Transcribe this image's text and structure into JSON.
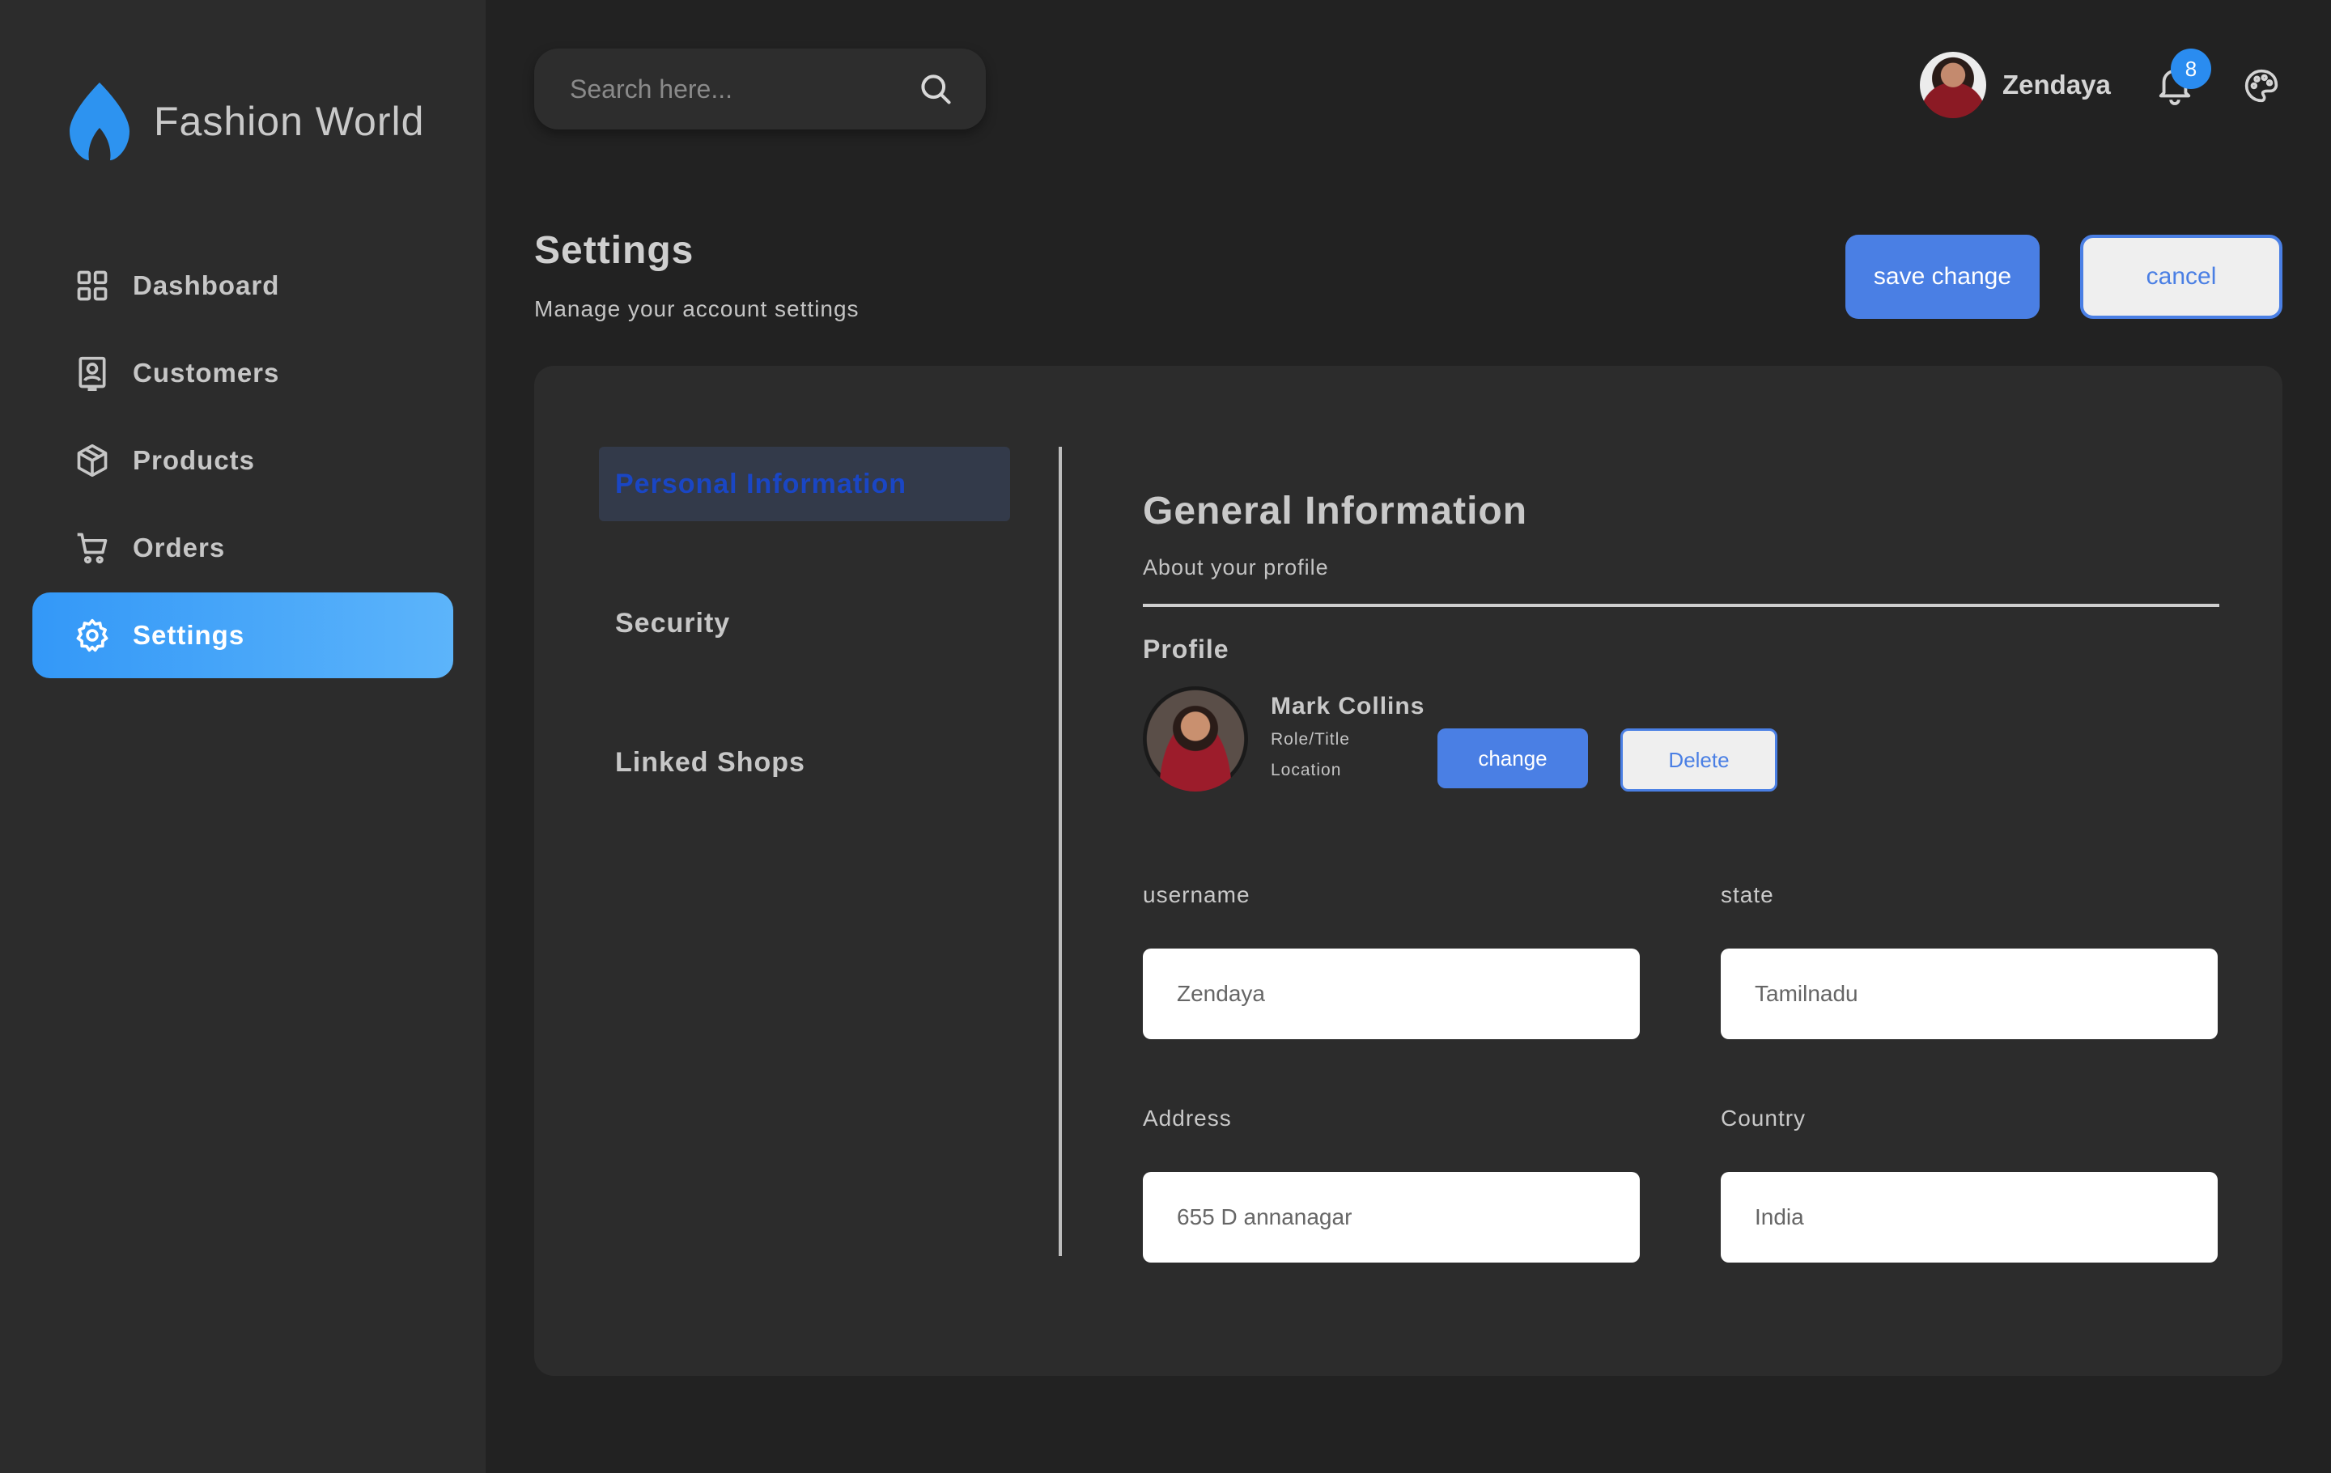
{
  "brand": {
    "name": "Fashion World"
  },
  "sidebar": {
    "items": [
      {
        "id": "dashboard",
        "label": "Dashboard",
        "icon": "grid-icon",
        "active": false
      },
      {
        "id": "customers",
        "label": "Customers",
        "icon": "contact-icon",
        "active": false
      },
      {
        "id": "products",
        "label": "Products",
        "icon": "box-icon",
        "active": false
      },
      {
        "id": "orders",
        "label": "Orders",
        "icon": "cart-icon",
        "active": false
      },
      {
        "id": "settings",
        "label": "Settings",
        "icon": "gear-icon",
        "active": true
      }
    ]
  },
  "search": {
    "placeholder": "Search here...",
    "value": ""
  },
  "header": {
    "user_name": "Zendaya",
    "notification_count": "8"
  },
  "page": {
    "title": "Settings",
    "subtitle": "Manage your account settings",
    "save_label": "save change",
    "cancel_label": "cancel"
  },
  "tabs": [
    {
      "label": "Personal Information",
      "active": true
    },
    {
      "label": "Security",
      "active": false
    },
    {
      "label": "Linked Shops",
      "active": false
    }
  ],
  "general": {
    "title": "General Information",
    "subtitle": "About your profile",
    "profile_label": "Profile",
    "profile_name": "Mark Collins",
    "profile_role": "Role/Title",
    "profile_location": "Location",
    "change_label": "change",
    "delete_label": "Delete"
  },
  "form": {
    "username": {
      "label": "username",
      "value": "Zendaya"
    },
    "state": {
      "label": "state",
      "value": "Tamilnadu"
    },
    "address": {
      "label": "Address",
      "value": "655 D annanagar"
    },
    "country": {
      "label": "Country",
      "value": "India"
    }
  },
  "colors": {
    "accent": "#3398f8",
    "primary_button": "#4a7fe4",
    "background": "#222222",
    "panel": "#2c2c2c"
  }
}
